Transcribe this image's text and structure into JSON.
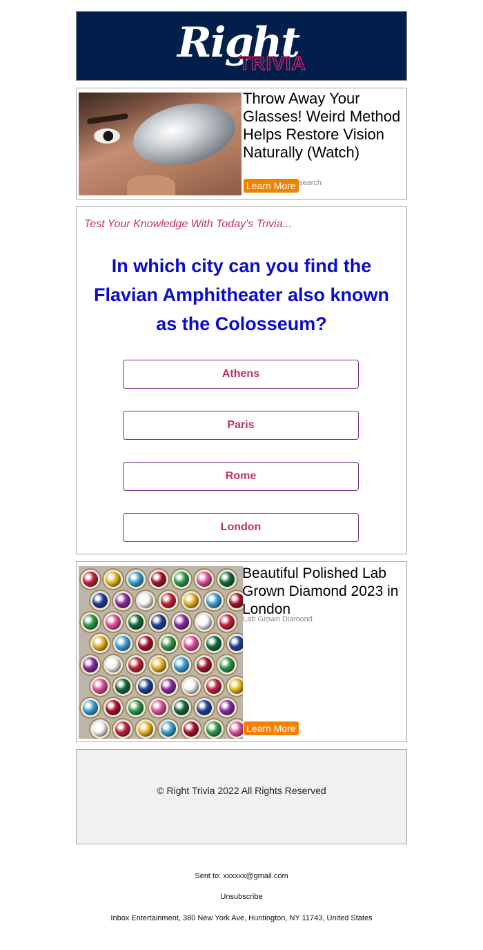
{
  "header": {
    "logo_word": "Right",
    "logo_sub": "TRIVIA"
  },
  "ad1": {
    "image_icon": "spoon-over-eye-photo",
    "title": "Throw Away Your Glasses! Weird Method Helps Restore Vision Naturally (Watch)",
    "source": "search",
    "button": "Learn More"
  },
  "trivia": {
    "intro": "Test Your Knowledge With Today's Trivia...",
    "question": "In which city can you find the Flavian Amphitheater also known as the Colosseum?",
    "answers": [
      "Athens",
      "Paris",
      "Rome",
      "London"
    ]
  },
  "ad2": {
    "image_icon": "gemstone-rings-photo",
    "title": "Beautiful Polished Lab Grown Diamond 2023 in London",
    "source": "Lab Grown Diamond",
    "button": "Learn More"
  },
  "footer": {
    "copyright": "© Right Trivia 2022 All Rights Reserved"
  },
  "meta": {
    "sent_to": "Sent to: xxxxxx@gmail.com",
    "unsubscribe": "Unsubscribe",
    "address": "Inbox Entertainment, 380 New York Ave, Huntington, NY 11743, United States"
  },
  "colors": {
    "header_bg": "#021f4b",
    "accent_pink": "#c0306a",
    "question_blue": "#0b0bcc",
    "button_orange": "#f28100"
  }
}
